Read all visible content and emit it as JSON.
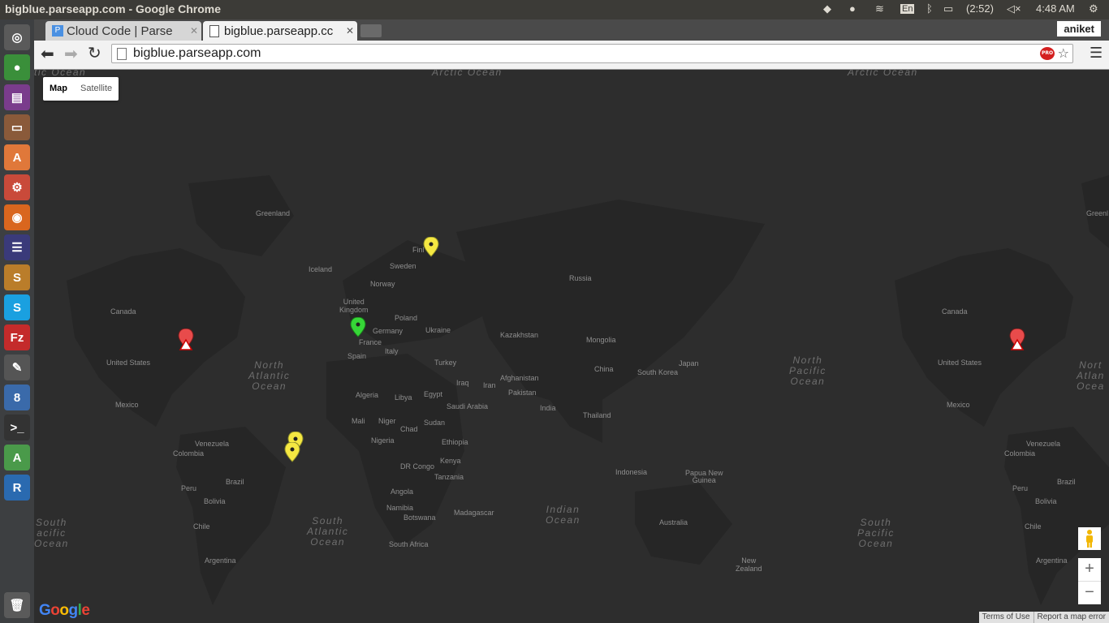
{
  "window": {
    "title": "bigblue.parseapp.com - Google Chrome"
  },
  "panel": {
    "keyboard": "En",
    "battery": "(2:52)",
    "clock": "4:48 AM"
  },
  "launcher": {
    "items": [
      {
        "name": "dash-icon",
        "glyph": "◎",
        "color": "#5a5a5a"
      },
      {
        "name": "chrome-icon",
        "glyph": "●",
        "color": "#3a8f3a"
      },
      {
        "name": "app-icon",
        "glyph": "▤",
        "color": "#7a3c8c"
      },
      {
        "name": "files-icon",
        "glyph": "▭",
        "color": "#8a5a3a"
      },
      {
        "name": "software-center-icon",
        "glyph": "A",
        "color": "#e0783a"
      },
      {
        "name": "settings-icon",
        "glyph": "⚙",
        "color": "#c94a3a"
      },
      {
        "name": "firefox-icon",
        "glyph": "◉",
        "color": "#d9661e"
      },
      {
        "name": "eclipse-icon",
        "glyph": "☰",
        "color": "#3a3a7a"
      },
      {
        "name": "sublime-icon",
        "glyph": "S",
        "color": "#ba7d2a"
      },
      {
        "name": "skype-icon",
        "glyph": "S",
        "color": "#1aa0e0"
      },
      {
        "name": "filezilla-icon",
        "glyph": "Fz",
        "color": "#c42b2b"
      },
      {
        "name": "inkscape-icon",
        "glyph": "✎",
        "color": "#555"
      },
      {
        "name": "keyring-icon",
        "glyph": "8",
        "color": "#3a6aaa"
      },
      {
        "name": "terminal-icon",
        "glyph": ">_",
        "color": "#333"
      },
      {
        "name": "android-studio-icon",
        "glyph": "A",
        "color": "#4a9a4a"
      },
      {
        "name": "r-icon",
        "glyph": "R",
        "color": "#2a6ab0"
      }
    ]
  },
  "browser": {
    "tabs": [
      {
        "label": "Cloud Code | Parse",
        "active": false
      },
      {
        "label": "bigblue.parseapp.cc",
        "active": true
      }
    ],
    "profile": "aniket",
    "url": "bigblue.parseapp.com",
    "pro_badge": "PRO"
  },
  "map": {
    "type_buttons": {
      "map": "Map",
      "satellite": "Satellite"
    },
    "oceans": {
      "arctic1": "Arctic Ocean",
      "arctic2": "Arctic Ocean",
      "arctic0": "tic Ocean",
      "north_atlantic": "North\nAtlantic\nOcean",
      "north_pacific": "North\nPacific\nOcean",
      "north_atlantic_right": "Nort\nAtlan\nOcea",
      "south_atlantic": "South\nAtlantic\nOcean",
      "indian": "Indian\nOcean",
      "south_pacific": "South\nPacific\nOcean",
      "south_pacific_left": "South\nacific\nOcean"
    },
    "labels": {
      "greenland": "Greenland",
      "greenland2": "Greenl",
      "iceland": "Iceland",
      "sweden": "Sweden",
      "finland": "Finl",
      "norway": "Norway",
      "uk": "United\nKingdom",
      "russia": "Russia",
      "canada": "Canada",
      "canada2": "Canada",
      "poland": "Poland",
      "germany": "Germany",
      "ukraine": "Ukraine",
      "kazakhstan": "Kazakhstan",
      "mongolia": "Mongolia",
      "france": "France",
      "italy": "Italy",
      "spain": "Spain",
      "us": "United States",
      "us2": "United States",
      "turkey": "Turkey",
      "iraq": "Iraq",
      "iran": "Iran",
      "afghanistan": "Afghanistan",
      "china": "China",
      "south_korea": "South Korea",
      "japan": "Japan",
      "pakistan": "Pakistan",
      "algeria": "Algeria",
      "libya": "Libya",
      "egypt": "Egypt",
      "saudi": "Saudi Arabia",
      "india": "India",
      "mexico": "Mexico",
      "mexico2": "Mexico",
      "thailand": "Thailand",
      "mali": "Mali",
      "niger": "Niger",
      "chad": "Chad",
      "sudan": "Sudan",
      "nigeria": "Nigeria",
      "ethiopia": "Ethiopia",
      "venezuela": "Venezuela",
      "venezuela2": "Venezuela",
      "colombia": "Colombia",
      "colombia2": "Colombia",
      "kenya": "Kenya",
      "drc": "DR Congo",
      "indonesia": "Indonesia",
      "png": "Papua New\nGuinea",
      "tanzania": "Tanzania",
      "peru": "Peru",
      "peru2": "Peru",
      "brazil": "Brazil",
      "brazil2": "Brazil",
      "angola": "Angola",
      "bolivia": "Bolivia",
      "bolivia2": "Bolivia",
      "namibia": "Namibia",
      "madagascar": "Madagascar",
      "botswana": "Botswana",
      "australia": "Australia",
      "chile": "Chile",
      "chile2": "Chile",
      "south_africa": "South Africa",
      "argentina": "Argentina",
      "argentina2": "Argentina",
      "nz": "New\nZealand"
    },
    "markers": [
      {
        "name": "marker-yellow-finland",
        "color": "#f5e842"
      },
      {
        "name": "marker-green-france",
        "color": "#36d637"
      },
      {
        "name": "marker-red-usa",
        "color": "#e84b4b"
      },
      {
        "name": "marker-red-usa-2",
        "color": "#e84b4b"
      },
      {
        "name": "marker-yellow-atlantic-1",
        "color": "#f5e842"
      },
      {
        "name": "marker-yellow-atlantic-2",
        "color": "#f5e842"
      }
    ],
    "zoom": {
      "in": "+",
      "out": "−"
    },
    "logo": "Google",
    "footer": {
      "terms": "Terms of Use",
      "report": "Report a map error"
    }
  }
}
